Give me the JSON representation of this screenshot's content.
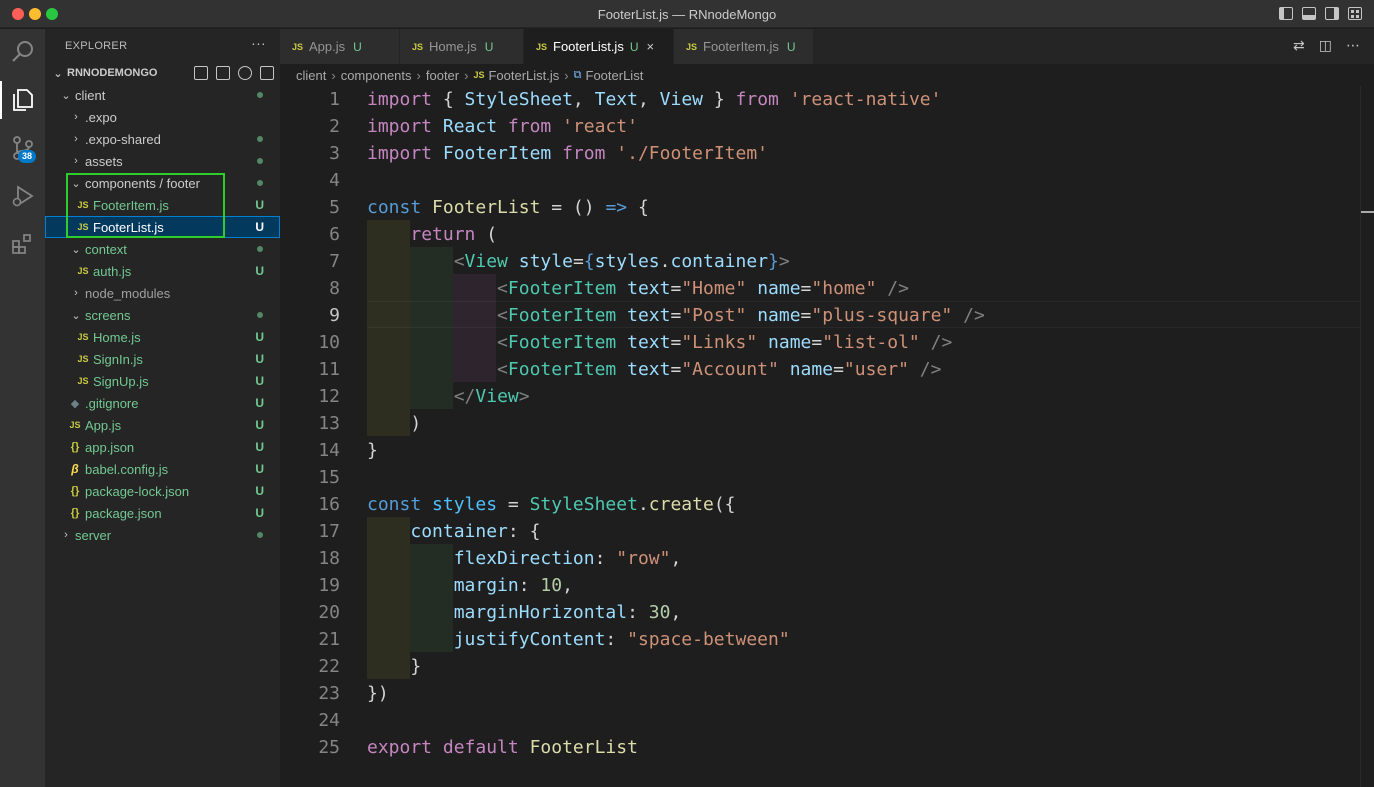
{
  "window": {
    "title": "FooterList.js — RNnodeMongo"
  },
  "activity_bar": {
    "badge_count": "38"
  },
  "explorer": {
    "header": "EXPLORER",
    "more": "···",
    "root": "RNNODEMONGO",
    "items": [
      {
        "label": "client",
        "status": ""
      },
      {
        "label": ".expo",
        "status": ""
      },
      {
        "label": ".expo-shared",
        "status": ""
      },
      {
        "label": "assets",
        "status": ""
      },
      {
        "label": "components / footer",
        "status": ""
      },
      {
        "label": "FooterItem.js",
        "status": "U"
      },
      {
        "label": "FooterList.js",
        "status": "U"
      },
      {
        "label": "context",
        "status": ""
      },
      {
        "label": "auth.js",
        "status": "U"
      },
      {
        "label": "node_modules",
        "status": ""
      },
      {
        "label": "screens",
        "status": ""
      },
      {
        "label": "Home.js",
        "status": "U"
      },
      {
        "label": "SignIn.js",
        "status": "U"
      },
      {
        "label": "SignUp.js",
        "status": "U"
      },
      {
        "label": ".gitignore",
        "status": "U"
      },
      {
        "label": "App.js",
        "status": "U"
      },
      {
        "label": "app.json",
        "status": "U"
      },
      {
        "label": "babel.config.js",
        "status": "U"
      },
      {
        "label": "package-lock.json",
        "status": "U"
      },
      {
        "label": "package.json",
        "status": "U"
      },
      {
        "label": "server",
        "status": ""
      }
    ]
  },
  "tabs": [
    {
      "label": "App.js",
      "status": "U"
    },
    {
      "label": "Home.js",
      "status": "U"
    },
    {
      "label": "FooterList.js",
      "status": "U",
      "close": "×"
    },
    {
      "label": "FooterItem.js",
      "status": "U"
    }
  ],
  "file_icon_tag": "JS",
  "breadcrumb": [
    "client",
    "components",
    "footer",
    "FooterList.js",
    "FooterList"
  ],
  "breadcrumb_sep": "›",
  "code": {
    "line_numbers": [
      "1",
      "2",
      "3",
      "4",
      "5",
      "6",
      "7",
      "8",
      "9",
      "10",
      "11",
      "12",
      "13",
      "14",
      "15",
      "16",
      "17",
      "18",
      "19",
      "20",
      "21",
      "22",
      "23",
      "24",
      "25"
    ],
    "current_line": "9",
    "lines": [
      [
        [
          "kw",
          "import"
        ],
        [
          "pn",
          " { "
        ],
        [
          "vr",
          "StyleSheet"
        ],
        [
          "pn",
          ", "
        ],
        [
          "vr",
          "Text"
        ],
        [
          "pn",
          ", "
        ],
        [
          "vr",
          "View"
        ],
        [
          "pn",
          " } "
        ],
        [
          "kw",
          "from"
        ],
        [
          "pn",
          " "
        ],
        [
          "str",
          "'react-native'"
        ]
      ],
      [
        [
          "kw",
          "import"
        ],
        [
          "pn",
          " "
        ],
        [
          "vr",
          "React"
        ],
        [
          "pn",
          " "
        ],
        [
          "kw",
          "from"
        ],
        [
          "pn",
          " "
        ],
        [
          "str",
          "'react'"
        ]
      ],
      [
        [
          "kw",
          "import"
        ],
        [
          "pn",
          " "
        ],
        [
          "vr",
          "FooterItem"
        ],
        [
          "pn",
          " "
        ],
        [
          "kw",
          "from"
        ],
        [
          "pn",
          " "
        ],
        [
          "str",
          "'./FooterItem'"
        ]
      ],
      [],
      [
        [
          "st",
          "const"
        ],
        [
          "pn",
          " "
        ],
        [
          "fn",
          "FooterList"
        ],
        [
          "pn",
          " = () "
        ],
        [
          "st",
          "=>"
        ],
        [
          "pn",
          " {"
        ]
      ],
      [
        [
          "pn",
          "    "
        ],
        [
          "kw",
          "return"
        ],
        [
          "pn",
          " ("
        ]
      ],
      [
        [
          "pn",
          "        "
        ],
        [
          "gr",
          "<"
        ],
        [
          "ty",
          "View"
        ],
        [
          "pn",
          " "
        ],
        [
          "vr",
          "style"
        ],
        [
          "pn",
          "="
        ],
        [
          "st",
          "{"
        ],
        [
          "vr",
          "styles"
        ],
        [
          "pn",
          "."
        ],
        [
          "vr",
          "container"
        ],
        [
          "st",
          "}"
        ],
        [
          "gr",
          ">"
        ]
      ],
      [
        [
          "pn",
          "            "
        ],
        [
          "gr",
          "<"
        ],
        [
          "ty",
          "FooterItem"
        ],
        [
          "pn",
          " "
        ],
        [
          "vr",
          "text"
        ],
        [
          "pn",
          "="
        ],
        [
          "str",
          "\"Home\""
        ],
        [
          "pn",
          " "
        ],
        [
          "vr",
          "name"
        ],
        [
          "pn",
          "="
        ],
        [
          "str",
          "\"home\""
        ],
        [
          "pn",
          " "
        ],
        [
          "gr",
          "/>"
        ]
      ],
      [
        [
          "pn",
          "            "
        ],
        [
          "gr",
          "<"
        ],
        [
          "ty",
          "FooterItem"
        ],
        [
          "pn",
          " "
        ],
        [
          "vr",
          "text"
        ],
        [
          "pn",
          "="
        ],
        [
          "str",
          "\"Post\""
        ],
        [
          "pn",
          " "
        ],
        [
          "vr",
          "name"
        ],
        [
          "pn",
          "="
        ],
        [
          "str",
          "\"plus-square\""
        ],
        [
          "pn",
          " "
        ],
        [
          "gr",
          "/>"
        ]
      ],
      [
        [
          "pn",
          "            "
        ],
        [
          "gr",
          "<"
        ],
        [
          "ty",
          "FooterItem"
        ],
        [
          "pn",
          " "
        ],
        [
          "vr",
          "text"
        ],
        [
          "pn",
          "="
        ],
        [
          "str",
          "\"Links\""
        ],
        [
          "pn",
          " "
        ],
        [
          "vr",
          "name"
        ],
        [
          "pn",
          "="
        ],
        [
          "str",
          "\"list-ol\""
        ],
        [
          "pn",
          " "
        ],
        [
          "gr",
          "/>"
        ]
      ],
      [
        [
          "pn",
          "            "
        ],
        [
          "gr",
          "<"
        ],
        [
          "ty",
          "FooterItem"
        ],
        [
          "pn",
          " "
        ],
        [
          "vr",
          "text"
        ],
        [
          "pn",
          "="
        ],
        [
          "str",
          "\"Account\""
        ],
        [
          "pn",
          " "
        ],
        [
          "vr",
          "name"
        ],
        [
          "pn",
          "="
        ],
        [
          "str",
          "\"user\""
        ],
        [
          "pn",
          " "
        ],
        [
          "gr",
          "/>"
        ]
      ],
      [
        [
          "pn",
          "        "
        ],
        [
          "gr",
          "</"
        ],
        [
          "ty",
          "View"
        ],
        [
          "gr",
          ">"
        ]
      ],
      [
        [
          "pn",
          "    )"
        ]
      ],
      [
        [
          "pn",
          "}"
        ]
      ],
      [],
      [
        [
          "st",
          "const"
        ],
        [
          "pn",
          " "
        ],
        [
          "cv",
          "styles"
        ],
        [
          "pn",
          " = "
        ],
        [
          "ty",
          "StyleSheet"
        ],
        [
          "pn",
          "."
        ],
        [
          "fn",
          "create"
        ],
        [
          "pn",
          "({"
        ]
      ],
      [
        [
          "pn",
          "    "
        ],
        [
          "vr",
          "container"
        ],
        [
          "pn",
          ": {"
        ]
      ],
      [
        [
          "pn",
          "        "
        ],
        [
          "vr",
          "flexDirection"
        ],
        [
          "pn",
          ": "
        ],
        [
          "str",
          "\"row\""
        ],
        [
          "pn",
          ","
        ]
      ],
      [
        [
          "pn",
          "        "
        ],
        [
          "vr",
          "margin"
        ],
        [
          "pn",
          ": "
        ],
        [
          "num",
          "10"
        ],
        [
          "pn",
          ","
        ]
      ],
      [
        [
          "pn",
          "        "
        ],
        [
          "vr",
          "marginHorizontal"
        ],
        [
          "pn",
          ": "
        ],
        [
          "num",
          "30"
        ],
        [
          "pn",
          ","
        ]
      ],
      [
        [
          "pn",
          "        "
        ],
        [
          "vr",
          "justifyContent"
        ],
        [
          "pn",
          ": "
        ],
        [
          "str",
          "\"space-between\""
        ]
      ],
      [
        [
          "pn",
          "    }"
        ]
      ],
      [
        [
          "pn",
          "})"
        ]
      ],
      [],
      [
        [
          "kw",
          "export"
        ],
        [
          "pn",
          " "
        ],
        [
          "kw",
          "default"
        ],
        [
          "pn",
          " "
        ],
        [
          "fn",
          "FooterList"
        ]
      ]
    ]
  }
}
